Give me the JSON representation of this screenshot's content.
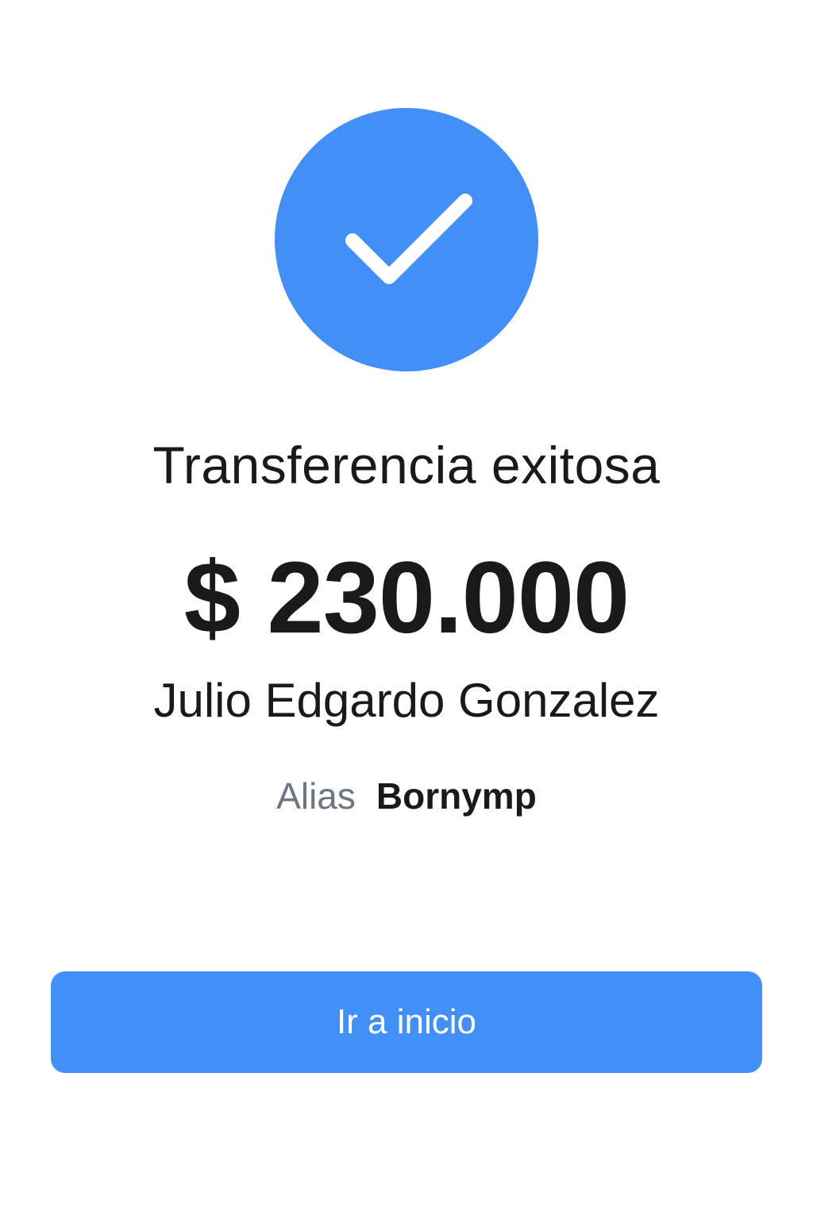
{
  "status_icon": "check-icon",
  "colors": {
    "accent": "#438ff8",
    "text_primary": "#1a1a1a",
    "text_secondary": "#6e7682",
    "background": "#ffffff"
  },
  "title": "Transferencia exitosa",
  "amount": "$ 230.000",
  "recipient_name": "Julio Edgardo Gonzalez",
  "alias": {
    "label": "Alias",
    "value": "Bornymp"
  },
  "home_button_label": "Ir a inicio"
}
